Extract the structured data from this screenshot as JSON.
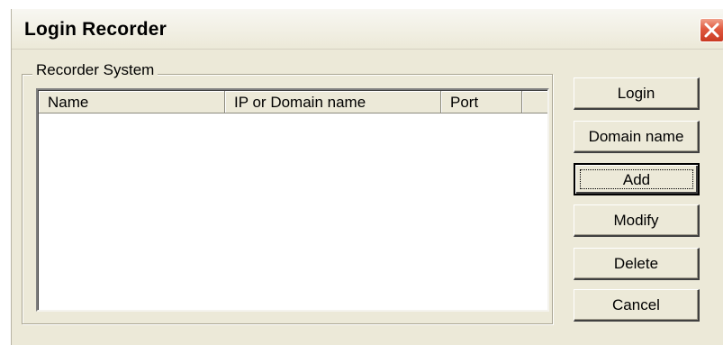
{
  "window": {
    "title": "Login Recorder",
    "close_icon": "close-icon",
    "close_color": "#e0593f"
  },
  "group": {
    "label": "Recorder System"
  },
  "list": {
    "columns": [
      "Name",
      "IP or Domain name",
      "Port",
      ""
    ],
    "rows": []
  },
  "buttons": {
    "login": "Login",
    "domain_name": "Domain name",
    "add": "Add",
    "modify": "Modify",
    "delete": "Delete",
    "cancel": "Cancel"
  }
}
